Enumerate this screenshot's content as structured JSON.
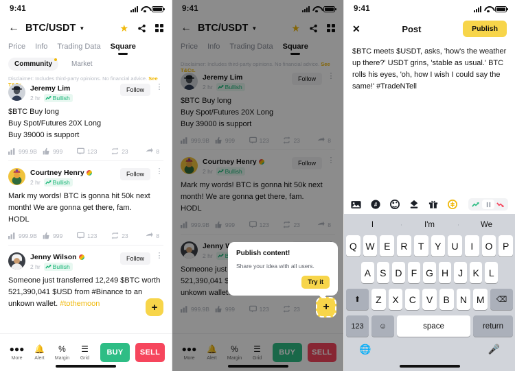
{
  "status_bar": {
    "time": "9:41",
    "signal_icon": "cellular-signal-icon",
    "wifi_icon": "wifi-icon",
    "battery_icon": "battery-icon"
  },
  "header": {
    "back_icon": "back-arrow-icon",
    "pair": "BTC/USDT",
    "caret_icon": "chevron-down-icon",
    "star_icon": "star-icon",
    "share_icon": "share-icon",
    "grid_icon": "grid-icon"
  },
  "tabs": [
    {
      "label": "Price",
      "active": false
    },
    {
      "label": "Info",
      "active": false
    },
    {
      "label": "Trading Data",
      "active": false
    },
    {
      "label": "Square",
      "active": true
    }
  ],
  "subtabs": [
    {
      "label": "Community",
      "active": true
    },
    {
      "label": "Market",
      "active": false
    }
  ],
  "disclaimer": {
    "text": "Disclaimer: Includes third-party opinions. No financial advice.",
    "link": "See T&Cs."
  },
  "posts": [
    {
      "user": "Jeremy Lim",
      "time": "2 hr",
      "sentiment": "Bullish",
      "follow_label": "Follow",
      "text": "$BTC Buy long\nBuy Spot/Futures 20X Long\nBuy 39000 is support",
      "stats": {
        "views": "999.9B",
        "likes": "999",
        "comments": "123",
        "reposts": "23",
        "shares": "8"
      }
    },
    {
      "user": "Courtney Henry",
      "time": "2 hr",
      "sentiment": "Bullish",
      "follow_label": "Follow",
      "text": "Mark my words! BTC is gonna hit 50k next month! We are gonna get there, fam.\nHODL",
      "stats": {
        "views": "999.9B",
        "likes": "999",
        "comments": "123",
        "reposts": "23",
        "shares": "8"
      }
    },
    {
      "user": "Jenny Wilson",
      "time": "2 hr",
      "sentiment": "Bullish",
      "follow_label": "Follow",
      "text": "Someone just transferred 12,249 $BTC worth 521,390,041 $USD from #Binance to an unkown wallet.",
      "hashtag": "#tothemoon",
      "stats": {
        "views": "999.9B",
        "likes": "999",
        "comments": "123",
        "reposts": "23",
        "shares": "8"
      }
    }
  ],
  "action_bar": {
    "items": [
      {
        "label": "More",
        "icon": "more-icon"
      },
      {
        "label": "Alert",
        "icon": "bell-icon"
      },
      {
        "label": "Margin",
        "icon": "percent-icon"
      },
      {
        "label": "Grid",
        "icon": "grid-trade-icon"
      }
    ],
    "buy_label": "BUY",
    "sell_label": "SELL",
    "buy_color": "#2ebd85",
    "sell_color": "#f6465d"
  },
  "fab": {
    "icon": "plus-icon",
    "color": "#f7d54a"
  },
  "tooltip": {
    "title": "Publish content!",
    "body": "Share your idea with all users.",
    "button": "Try it"
  },
  "compose": {
    "close_icon": "close-icon",
    "title": "Post",
    "publish_label": "Publish",
    "publish_color": "#f7d54a",
    "body": "$BTC meets $USDT, asks, 'how's the weather up there?' USDT grins, 'stable as usual.' BTC rolls his eyes, 'oh, how I wish I could say the same!' #TradeNTell",
    "toolbar_icons": [
      "image-icon",
      "hashtag-icon",
      "mention-sticker-icon",
      "poll-icon",
      "gift-icon",
      "coin-icon"
    ],
    "sentiment_segments": [
      {
        "name": "bullish-arrow-icon",
        "selected": false
      },
      {
        "name": "neutral-pause-icon",
        "selected": true
      },
      {
        "name": "bearish-arrow-icon",
        "selected": false
      }
    ]
  },
  "keyboard": {
    "predictions": [
      "I",
      "I'm",
      "We"
    ],
    "row1": [
      "Q",
      "W",
      "E",
      "R",
      "T",
      "Y",
      "U",
      "I",
      "O",
      "P"
    ],
    "row2": [
      "A",
      "S",
      "D",
      "F",
      "G",
      "H",
      "J",
      "K",
      "L"
    ],
    "row3": [
      "Z",
      "X",
      "C",
      "V",
      "B",
      "N",
      "M"
    ],
    "shift_icon": "shift-icon",
    "backspace_icon": "backspace-icon",
    "numeric_label": "123",
    "emoji_icon": "emoji-icon",
    "space_label": "space",
    "return_label": "return",
    "globe_icon": "globe-icon",
    "mic_icon": "microphone-icon"
  }
}
